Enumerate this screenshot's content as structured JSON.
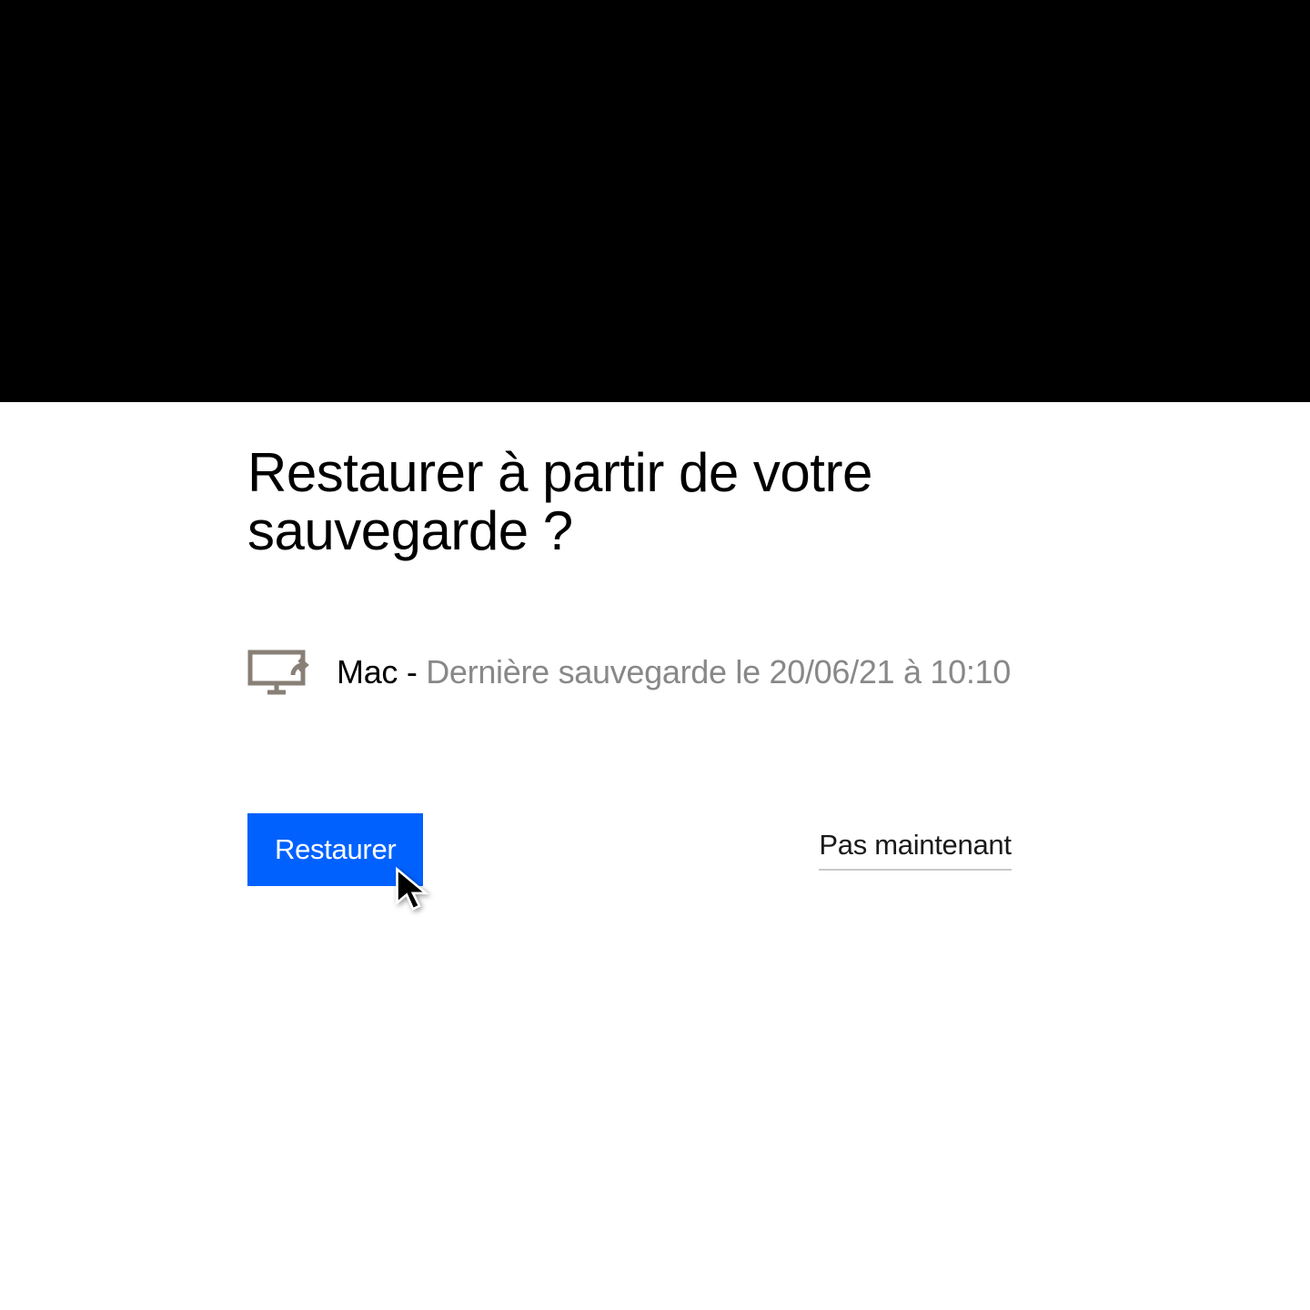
{
  "heading": "Restaurer à partir de votre sauvegarde ?",
  "backup": {
    "device": "Mac",
    "separator": " - ",
    "detail": "Dernière sauvegarde le 20/06/21 à 10:10"
  },
  "buttons": {
    "primary": "Restaurer",
    "secondary": "Pas maintenant"
  },
  "colors": {
    "accent": "#0061fe",
    "icon": "#887f76",
    "muted": "#888888"
  }
}
